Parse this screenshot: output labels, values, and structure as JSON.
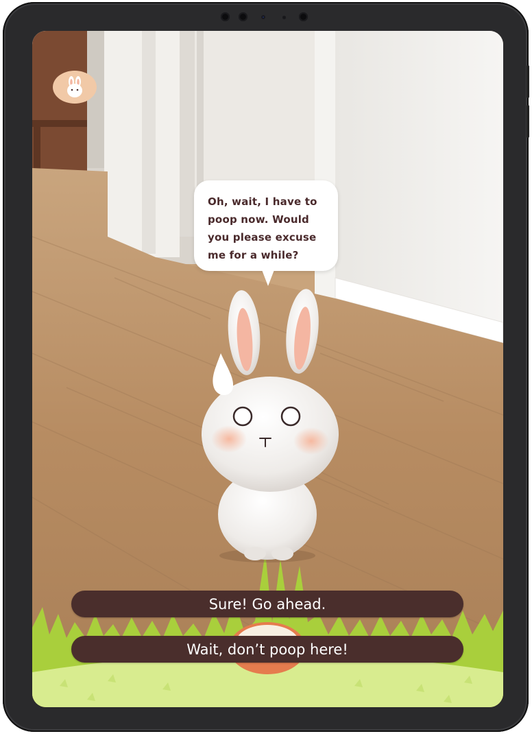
{
  "app": {
    "profile_icon": "bunny-face-icon"
  },
  "bubble": {
    "text": "Oh, wait, I have to poop now. Would you please excuse me for a while?"
  },
  "choices": [
    {
      "label": "Sure! Go ahead."
    },
    {
      "label": "Wait, don’t poop here!"
    }
  ],
  "colors": {
    "choice_bg": "#4a2e2c",
    "bubble_text": "#4a2a2c",
    "grass": "#a9cf3c",
    "grass_light": "#d8ec8f",
    "profile_bg": "#f1c9a7"
  }
}
